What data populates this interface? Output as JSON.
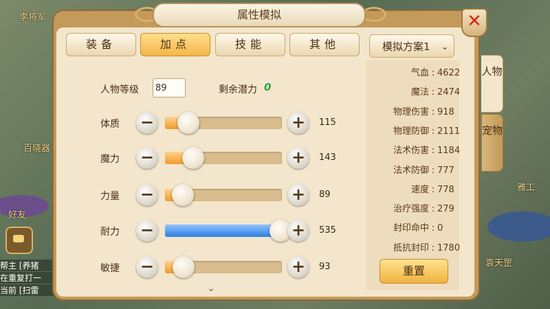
{
  "background": {
    "texts": [
      "李将军",
      "百晓器",
      "好友",
      "帮主",
      "[养猪",
      "在重复打一",
      "当前",
      "[扫雷",
      "雅工",
      "袁天罡"
    ],
    "chat": [
      "帮主 [养猪",
      "在重复打一",
      "当前 [扫雷"
    ]
  },
  "panel": {
    "title": "属性模拟",
    "close_symbol": "✕"
  },
  "tabs": [
    {
      "label": "装备",
      "active": false
    },
    {
      "label": "加点",
      "active": true
    },
    {
      "label": "技能",
      "active": false
    },
    {
      "label": "其他",
      "active": false
    }
  ],
  "level": {
    "label": "人物等级",
    "value": "89"
  },
  "potential": {
    "label": "剩余潜力",
    "value": "0"
  },
  "attributes": [
    {
      "name": "体质",
      "value": "115",
      "slider_fraction": 0.2,
      "color": "orange"
    },
    {
      "name": "魔力",
      "value": "143",
      "slider_fraction": 0.24,
      "color": "orange"
    },
    {
      "name": "力量",
      "value": "89",
      "slider_fraction": 0.15,
      "color": "orange"
    },
    {
      "name": "耐力",
      "value": "535",
      "slider_fraction": 0.99,
      "color": "blue"
    },
    {
      "name": "敏捷",
      "value": "93",
      "slider_fraction": 0.16,
      "color": "orange"
    }
  ],
  "buttons": {
    "minus": "−",
    "plus": "+",
    "reset": "重置"
  },
  "plan": {
    "label": "模拟方案1",
    "chevron": "⌄"
  },
  "stats": [
    {
      "key": "气血",
      "value": "4622"
    },
    {
      "key": "魔法",
      "value": "2474"
    },
    {
      "key": "物理伤害",
      "value": "918"
    },
    {
      "key": "物理防御",
      "value": "2111"
    },
    {
      "key": "法术伤害",
      "value": "1184"
    },
    {
      "key": "法术防御",
      "value": "777"
    },
    {
      "key": "速度",
      "value": "778"
    },
    {
      "key": "治疗强度",
      "value": "279"
    },
    {
      "key": "封印命中",
      "value": "0"
    },
    {
      "key": "抵抗封印",
      "value": "1780"
    }
  ],
  "side_tabs": [
    {
      "label": "人物",
      "active": true
    },
    {
      "label": "宠物",
      "active": false
    }
  ],
  "colors": {
    "accent_orange": "#f19a2e",
    "accent_blue": "#2f7fe0",
    "potential_green": "#2fa24a",
    "close_red": "#d52a1a"
  }
}
